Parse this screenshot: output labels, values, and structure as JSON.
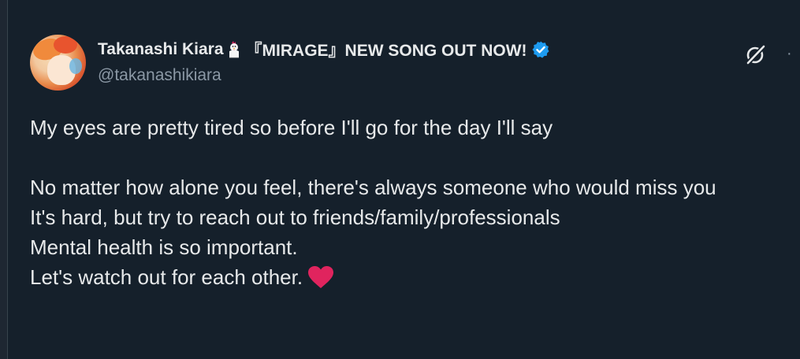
{
  "author": {
    "display_name": "Takanashi Kiara",
    "name_suffix": "『MIRAGE』NEW SONG OUT NOW!",
    "handle": "@takanashikiara",
    "verified": true,
    "name_emoji": "chicken-icon"
  },
  "actions": {
    "grok_icon": "grok-icon",
    "more_label": "·"
  },
  "tweet": {
    "lines": [
      "My eyes are pretty tired so before I'll go for the day I'll say",
      "",
      "No matter how alone you feel, there's always someone who would miss you",
      "It's hard, but try to reach out to friends/family/professionals",
      "Mental health is so important.",
      "Let's watch out for each other."
    ],
    "trailing_emoji": "heart-icon"
  },
  "colors": {
    "background": "#15202b",
    "text": "#e7e9ea",
    "muted": "#8b98a5",
    "verified": "#1d9bf0",
    "heart": "#e0245e"
  }
}
